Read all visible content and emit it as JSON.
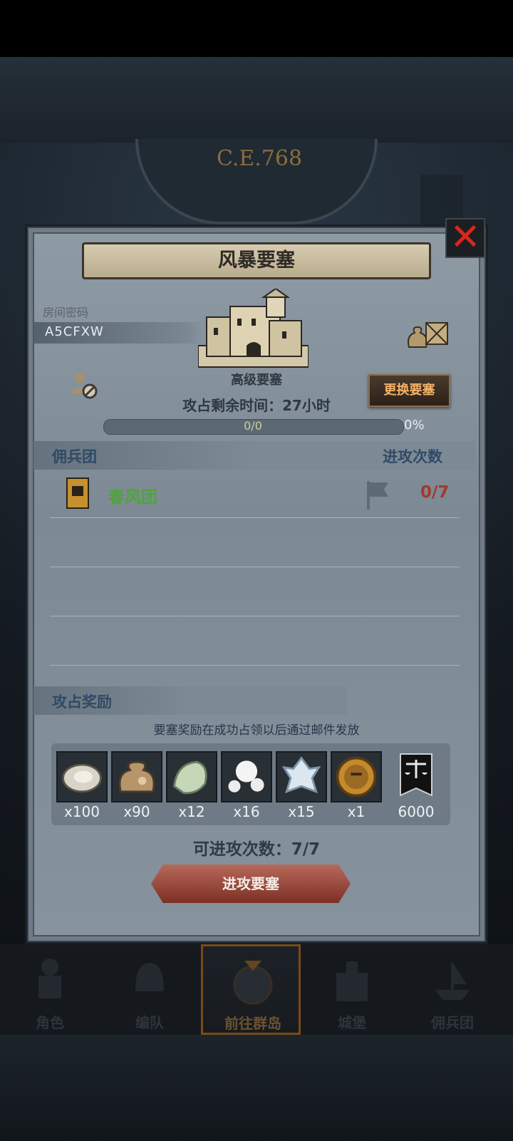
{
  "background": {
    "era": "C.E.768"
  },
  "dialog": {
    "title": "风暴要塞",
    "room_code_label": "房间密码",
    "room_code": "A5CFXW",
    "fortress_type": "高级要塞",
    "change_button": "更换要塞",
    "time_left": "攻占剩余时间：27小时",
    "progress": {
      "text": "0/0",
      "percent": "0%",
      "value": 0
    },
    "guild_header": "佣兵团",
    "attacks_header": "进攻次数",
    "guild": {
      "name": "春风团",
      "attacks": "0/7"
    },
    "rewards_header": "攻占奖励",
    "rewards_note": "要塞奖励在成功占领以后通过邮件发放",
    "rewards": [
      {
        "icon": "oyster-icon",
        "qty": "x100"
      },
      {
        "icon": "sack-icon",
        "qty": "x90"
      },
      {
        "icon": "pale-stone-icon",
        "qty": "x12"
      },
      {
        "icon": "pearls-icon",
        "qty": "x16"
      },
      {
        "icon": "crystal-icon",
        "qty": "x15"
      },
      {
        "icon": "knight-medal-icon",
        "qty": "x1"
      },
      {
        "icon": "scales-banner-icon",
        "qty": "6000"
      }
    ],
    "attack_count": "可进攻次数：7/7",
    "attack_button": "进攻要塞"
  },
  "nav": [
    {
      "label": "角色",
      "icon": "knight-icon",
      "active": false
    },
    {
      "label": "编队",
      "icon": "helmet-icon",
      "active": false
    },
    {
      "label": "前往群岛",
      "icon": "compass-map-icon",
      "active": true
    },
    {
      "label": "城堡",
      "icon": "castle-icon",
      "active": false
    },
    {
      "label": "佣兵团",
      "icon": "guild-ship-icon",
      "active": false
    }
  ],
  "colors": {
    "accent_gold": "#f3b26a",
    "guild_green": "#4fa43a",
    "attacks_red": "#a03a2e",
    "close_red": "#d8261a"
  }
}
